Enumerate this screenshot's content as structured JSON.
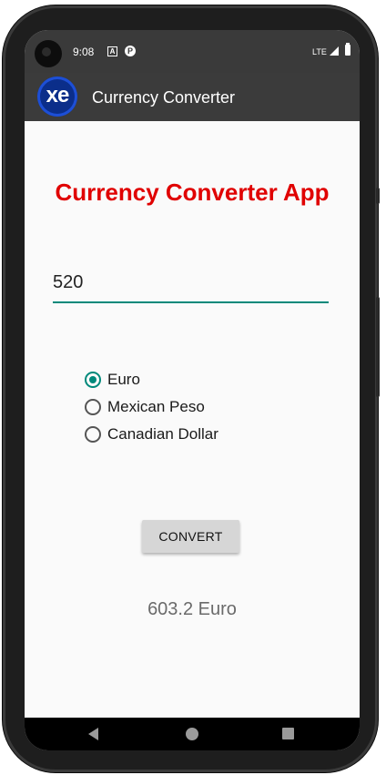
{
  "status_bar": {
    "time": "9:08",
    "notif_a": "A",
    "notif_p": "P",
    "network": "LTE",
    "icons": [
      "notification-a-icon",
      "notification-p-icon",
      "signal-icon",
      "battery-icon"
    ]
  },
  "app_bar": {
    "logo_text": "xe",
    "title": "Currency Converter"
  },
  "main": {
    "heading": "Currency Converter App",
    "heading_color": "#e00000",
    "amount_value": "520",
    "accent_color": "#00897b",
    "currencies": [
      {
        "label": "Euro",
        "checked": true
      },
      {
        "label": "Mexican Peso",
        "checked": false
      },
      {
        "label": "Canadian Dollar",
        "checked": false
      }
    ],
    "convert_label": "CONVERT",
    "result": "603.2 Euro"
  },
  "nav_bar": {
    "icons": [
      "back-icon",
      "home-icon",
      "recents-icon"
    ]
  }
}
